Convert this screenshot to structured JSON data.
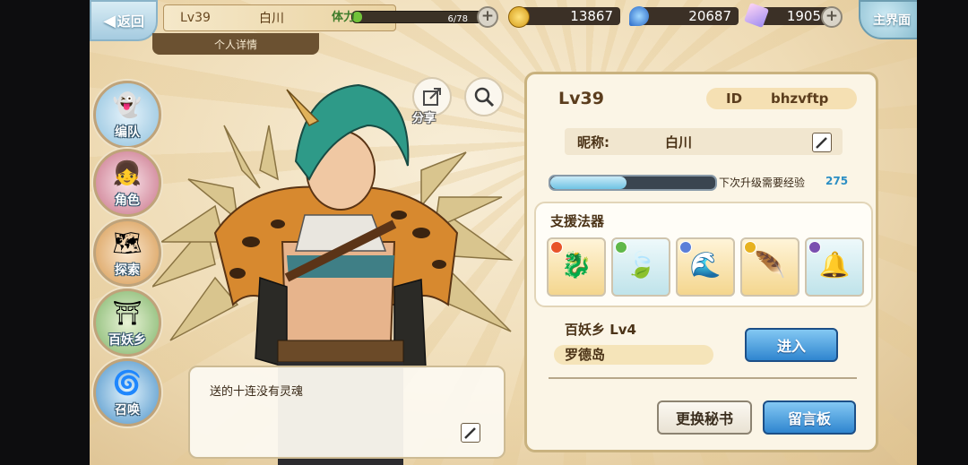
{
  "header": {
    "back_label": "返回",
    "level": "Lv39",
    "player_name": "白川",
    "detail_tab": "个人详情",
    "stamina_label": "体力",
    "stamina_value": "6/78",
    "stamina_fraction": 0.077,
    "gold": "13867",
    "spirit": "20687",
    "crystal": "1905",
    "home_label": "主界面"
  },
  "sidebar": {
    "items": [
      {
        "label": "编队",
        "icon": "team-icon"
      },
      {
        "label": "角色",
        "icon": "character-icon"
      },
      {
        "label": "探索",
        "icon": "explore-icon"
      },
      {
        "label": "百妖乡",
        "icon": "village-icon"
      },
      {
        "label": "召唤",
        "icon": "summon-icon"
      }
    ]
  },
  "actions": {
    "share_label": "分享"
  },
  "dialog": {
    "text": "送的十连没有灵魂"
  },
  "profile": {
    "level": "Lv39",
    "id_label": "ID",
    "id_value": "bhzvftp",
    "nickname_label": "昵称:",
    "nickname_value": "白川",
    "exp_label": "下次升级需要经验",
    "exp_value": "275",
    "exp_fraction": 0.46,
    "artifacts_title": "支援法器",
    "artifacts": [
      {
        "icon": "red-dragon-artifact-icon",
        "color": "#e8542a"
      },
      {
        "icon": "green-leaf-artifact-icon",
        "color": "#5fb84a"
      },
      {
        "icon": "blue-wave-artifact-icon",
        "color": "#5b7fd8"
      },
      {
        "icon": "golden-feather-artifact-icon",
        "color": "#e7b21f"
      },
      {
        "icon": "dark-bell-artifact-icon",
        "color": "#7a4fb0"
      }
    ],
    "village": "百妖乡  Lv4",
    "island": "罗德岛",
    "enter_label": "进入",
    "change_secretary_label": "更换秘书",
    "message_board_label": "留言板"
  },
  "colors": {
    "accent_blue": "#2f85cf",
    "panel_bg": "#fbf5e6",
    "stamina_green": "#72c33a",
    "exp_blue": "#6fc3e4"
  }
}
